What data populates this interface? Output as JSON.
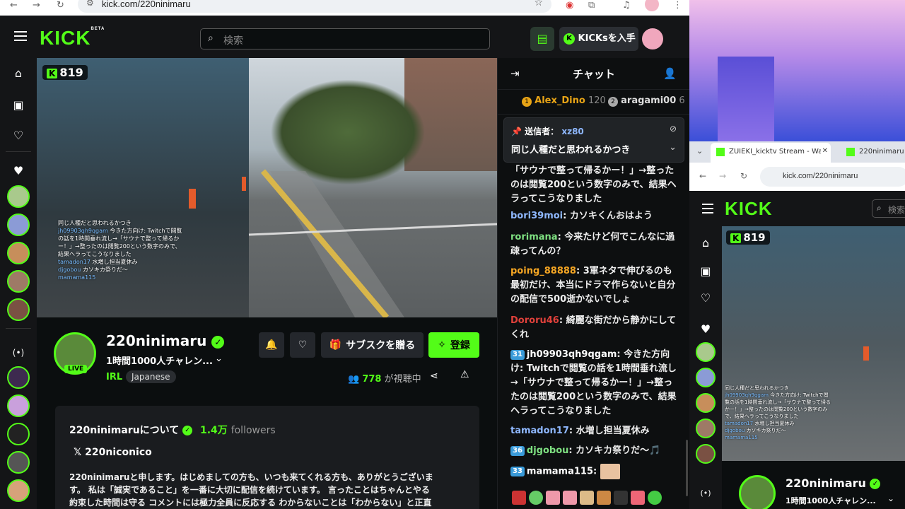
{
  "browser": {
    "url": "kick.com/220ninimaru"
  },
  "header": {
    "logo": "KICK",
    "logo_beta": "BETA",
    "search_placeholder": "検索",
    "get_kicks_label": "KICKsを入手"
  },
  "player": {
    "viewer_count": "819",
    "overlay_lines": [
      {
        "user": "",
        "text": "同じ人種だと思われるかつき"
      },
      {
        "user": "jh09903qh9qgam",
        "text": "今きた方向け: Twitchで閲覧の話を1時間垂れ流し→「サウナで整って帰るかー！」→整ったのは閲覧200という数字のみで、結果ヘラってこうなりました"
      },
      {
        "user": "tamadon17",
        "text": "水増し担当夏休み"
      },
      {
        "user": "djgobou",
        "text": "カソキカ祭りだ〜"
      },
      {
        "user": "mamama115",
        "text": ""
      }
    ]
  },
  "channel": {
    "name": "220ninimaru",
    "live_label": "LIVE",
    "title": "1時間1000人チャレン...",
    "category": "IRL",
    "tag": "Japanese",
    "gift_sub_label": "サブスクを贈る",
    "subscribe_label": "登録",
    "viewers": "778",
    "viewers_suffix": "が視聴中",
    "about_title": "220ninimaruについて",
    "followers_count": "1.4万",
    "followers_label": "followers",
    "x_handle": "220niconico",
    "bio_lines": [
      "220ninimaruと申します。はじめましての方も、いつも来てくれる方も、ありがとうございま",
      "す。 私は「誠実であること」を一番に大切に配信を続けています。 言ったことはちゃんとやる",
      "約束した時間は守る コメントには極力全員に反応する わからないことは「わからない」と正直"
    ]
  },
  "chat": {
    "title": "チャット",
    "leaderboard": [
      {
        "rank": "1",
        "user": "Alex_Dino",
        "score": "120"
      },
      {
        "rank": "2",
        "user": "aragami00",
        "score": "6"
      }
    ],
    "pinned": {
      "label": "送信者：",
      "user": "xz80",
      "text": "同じ人種だと思われるかつき"
    },
    "messages": [
      {
        "badge": "",
        "user": "",
        "color": "#ffffff",
        "text": "「サウナで整って帰るかー！」→整ったのは閲覧200という数字のみで、結果ヘラってこうなりました"
      },
      {
        "badge": "",
        "user": "bori39moi",
        "color": "#8fb8ff",
        "text": "カソキくんおはよう"
      },
      {
        "badge": "",
        "user": "rorimana",
        "color": "#7ee081",
        "text": "今来たけど何でこんなに過疎ってんの？"
      },
      {
        "badge": "",
        "user": "poing_88888",
        "color": "#f5a623",
        "text": "3軍ネタで伸びるのも最初だけ、本当にドラマ作らないと自分の配信で500逝かないでしょ"
      },
      {
        "badge": "",
        "user": "Dororu46",
        "color": "#e0413b",
        "text": "綺麗な街だから静かにしてくれ"
      },
      {
        "badge": "31",
        "user": "jh09903qh9qgam",
        "color": "#ffffff",
        "text": "今きた方向け: Twitchで閲覧の話を1時間垂れ流し→「サウナで整って帰るかー！」→整ったのは閲覧200という数字のみで、結果ヘラってこうなりました"
      },
      {
        "badge": "",
        "user": "tamadon17",
        "color": "#8fb8ff",
        "text": "水増し担当夏休み"
      },
      {
        "badge": "36",
        "user": "djgobou",
        "color": "#7ee081",
        "text": "カソキカ祭りだ〜🎵"
      },
      {
        "badge": "33",
        "user": "mamama115",
        "color": "#ffffff",
        "text": ""
      }
    ]
  },
  "second_window": {
    "tab1_label": "ZUIEKI_kicktv Stream - Watc",
    "tab2_label": "220ninimaru S",
    "url": "kick.com/220ninimaru",
    "logo": "KICK",
    "search_placeholder": "検索",
    "viewer_count": "819",
    "channel_name": "220ninimaru",
    "channel_title": "1時間1000人チャレン..."
  },
  "colors": {
    "brand": "#53fc18",
    "background": "#0b0e0f",
    "panel": "#141517"
  }
}
